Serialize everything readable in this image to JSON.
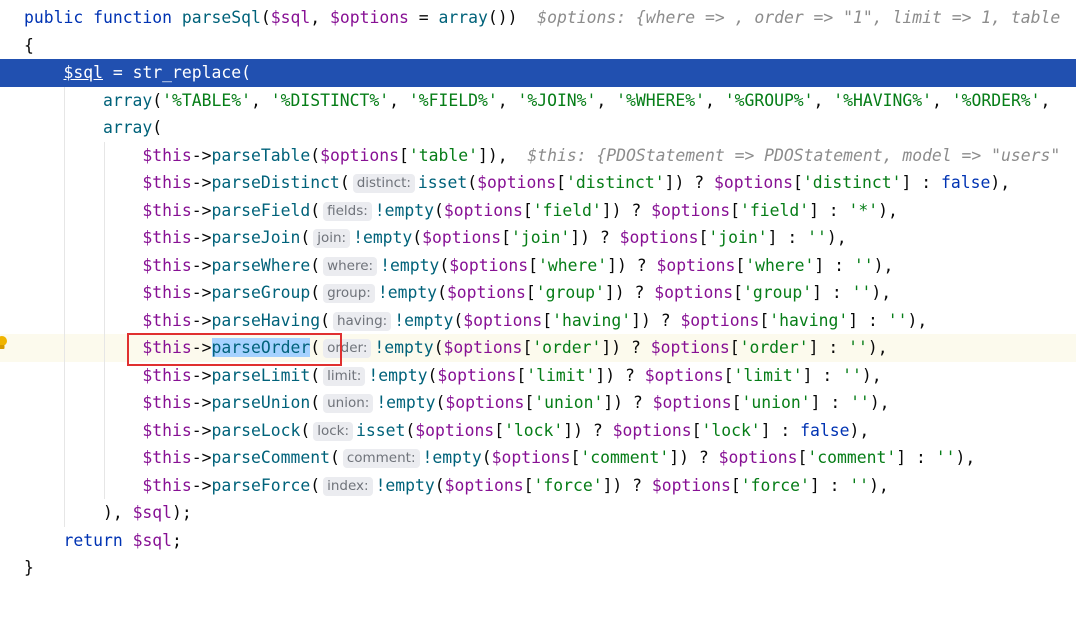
{
  "editor": {
    "signature": {
      "kw_public": "public",
      "kw_function": "function",
      "fn_name": "parseSql",
      "open_paren": "(",
      "param1": "$sql",
      "comma": ", ",
      "param2": "$options",
      "eq": " = ",
      "fn_array": "array",
      "close": "())",
      "hint": "$options: {where => , order => \"1\", limit => 1, table"
    },
    "open_brace": "{",
    "assign": {
      "var": "$sql",
      "eq": " = ",
      "fn": "str_replace",
      "paren": "("
    },
    "array_line": {
      "fn": "array",
      "open": "(",
      "items": [
        "'%TABLE%'",
        "'%DISTINCT%'",
        "'%FIELD%'",
        "'%JOIN%'",
        "'%WHERE%'",
        "'%GROUP%'",
        "'%HAVING%'",
        "'%ORDER%'"
      ],
      "sep": ", ",
      "trail": ","
    },
    "array2_line": {
      "fn": "array",
      "open": "("
    },
    "table_line": {
      "this": "$this",
      "arrow": "->",
      "method": "parseTable",
      "open": "(",
      "var": "$options",
      "key": "'table'",
      "close": "]),",
      "hint": "$this: {PDOStatement => PDOStatement, model => \"users\""
    },
    "calls": [
      {
        "method": "parseDistinct",
        "hint": "distinct:",
        "check": "isset",
        "key": "'distinct'",
        "fallback": "false",
        "fallback_kind": "kw"
      },
      {
        "method": "parseField",
        "hint": "fields:",
        "check": "!empty",
        "key": "'field'",
        "fallback": "'*'",
        "fallback_kind": "str"
      },
      {
        "method": "parseJoin",
        "hint": "join:",
        "check": "!empty",
        "key": "'join'",
        "fallback": "''",
        "fallback_kind": "str"
      },
      {
        "method": "parseWhere",
        "hint": "where:",
        "check": "!empty",
        "key": "'where'",
        "fallback": "''",
        "fallback_kind": "str"
      },
      {
        "method": "parseGroup",
        "hint": "group:",
        "check": "!empty",
        "key": "'group'",
        "fallback": "''",
        "fallback_kind": "str"
      },
      {
        "method": "parseHaving",
        "hint": "having:",
        "check": "!empty",
        "key": "'having'",
        "fallback": "''",
        "fallback_kind": "str"
      },
      {
        "method": "parseOrder",
        "hint": "order:",
        "check": "!empty",
        "key": "'order'",
        "fallback": "''",
        "fallback_kind": "str"
      },
      {
        "method": "parseLimit",
        "hint": "limit:",
        "check": "!empty",
        "key": "'limit'",
        "fallback": "''",
        "fallback_kind": "str"
      },
      {
        "method": "parseUnion",
        "hint": "union:",
        "check": "!empty",
        "key": "'union'",
        "fallback": "''",
        "fallback_kind": "str"
      },
      {
        "method": "parseLock",
        "hint": "lock:",
        "check": "isset",
        "key": "'lock'",
        "fallback": "false",
        "fallback_kind": "kw"
      },
      {
        "method": "parseComment",
        "hint": "comment:",
        "check": "!empty",
        "key": "'comment'",
        "fallback": "''",
        "fallback_kind": "str"
      },
      {
        "method": "parseForce",
        "hint": "index:",
        "check": "!empty",
        "key": "'force'",
        "fallback": "''",
        "fallback_kind": "str"
      }
    ],
    "call_parts": {
      "this": "$this",
      "arrow": "->",
      "open": "(",
      "var": "$options",
      "lbr": "[",
      "rbr_paren": "])",
      "q": " ? ",
      "rbr": "]",
      "colon": " : ",
      "end": "),"
    },
    "closing_line": {
      "paren": "), ",
      "var": "$sql",
      "end": ");"
    },
    "return_line": {
      "kw": "return",
      "var": " $sql",
      "end": ";"
    },
    "close_brace": "}"
  },
  "colors": {
    "keyword": "#0033b3",
    "variable": "#871094",
    "string": "#067d17",
    "function": "#00627a",
    "selection_line": "#2150b0",
    "highlight_box": "#e03030"
  }
}
